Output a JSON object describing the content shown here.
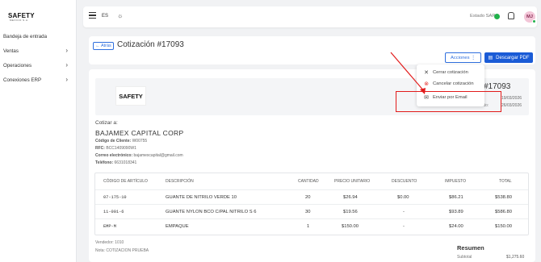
{
  "brand": {
    "name": "SAFETY",
    "tagline": "MEXICO S.A."
  },
  "sidebar": {
    "items": [
      {
        "label": "Bandeja de entrada",
        "chevron": false
      },
      {
        "label": "Ventas",
        "chevron": true
      },
      {
        "label": "Operaciones",
        "chevron": true
      },
      {
        "label": "Conexiones ERP",
        "chevron": true
      }
    ]
  },
  "topbar": {
    "lang": "ES",
    "sap_status": "Estado SAP",
    "avatar_initials": "MJ"
  },
  "header": {
    "back_label": "← Atrás",
    "title": "Cotización #17093",
    "acciones_label": "Acciones  ⋮",
    "descargar_label": "Descargar PDF"
  },
  "dropdown": {
    "items": [
      {
        "label": "Cerrar cotización",
        "icon": "close-icon"
      },
      {
        "label": "Cancelar cotización",
        "icon": "cancel-icon"
      },
      {
        "label": "Enviar por Email",
        "icon": "mail-icon"
      }
    ]
  },
  "document": {
    "logo_text": "SAFETY",
    "folio": "#17093",
    "date1": "19/03/2026",
    "date2_label": "Fecha de vencimiento:",
    "date2": "26/03/2026",
    "cotizar_a": "Cotizar a:",
    "client_name": "BAJAMEX CAPITAL CORP",
    "fields": [
      {
        "label": "Código de Cliente:",
        "value": "W00755"
      },
      {
        "label": "RFC:",
        "value": "BCC1409090W1"
      },
      {
        "label": "Correo electrónico:",
        "value": "bajamexcapital@gmail.com"
      },
      {
        "label": "Teléfono:",
        "value": "6631018341"
      }
    ]
  },
  "table": {
    "headers": [
      "CÓDIGO DE ARTÍCULO",
      "DESCRIPCIÓN",
      "CANTIDAD",
      "PRECIO UNITARIO",
      "DESCUENTO",
      "IMPUESTO",
      "TOTAL"
    ],
    "rows": [
      {
        "code": "07-175-10",
        "desc": "GUANTE DE NITRILO VERDE 10",
        "qty": "20",
        "price": "$26.94",
        "discount": "$0.00",
        "tax": "$86.21",
        "total": "$538.80"
      },
      {
        "code": "11-001-6",
        "desc": "GUANTE NYLON BCO C/PAL NITRILO S 6",
        "qty": "30",
        "price": "$19.56",
        "discount": "-",
        "tax": "$93.89",
        "total": "$586.80"
      },
      {
        "code": "EMP-M",
        "desc": "EMPAQUE",
        "qty": "1",
        "price": "$150.00",
        "discount": "-",
        "tax": "$24.00",
        "total": "$150.00"
      }
    ]
  },
  "notes": {
    "vendedor": "Vendedor: 1010",
    "nota": "Nota: COTIZACION PRUEBA"
  },
  "summary": {
    "title": "Resumen",
    "subtotal_label": "Subtotal",
    "subtotal_value": "$1,275.60"
  },
  "colors": {
    "accent": "#1a5bd6",
    "highlight": "#e21b1b",
    "status_ok": "#21b14b"
  }
}
